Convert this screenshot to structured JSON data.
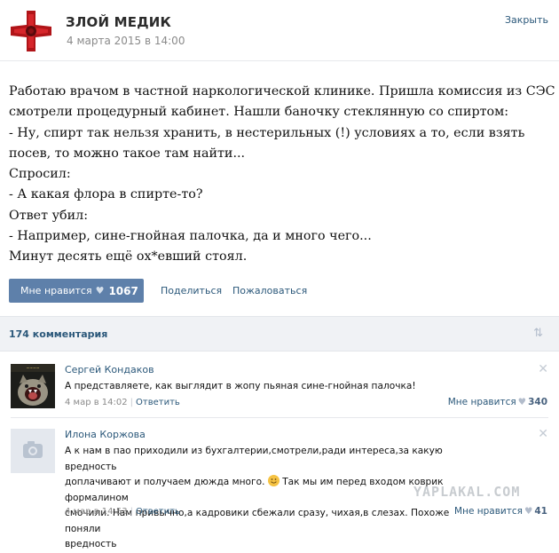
{
  "post": {
    "author": "ЗЛОЙ МЕДИК",
    "date": "4 марта 2015 в 14:00",
    "close_label": "Закрыть",
    "lines": [
      "Работаю врачом в частной наркологической клинике. Пришла комиссия из СЭС -",
      "смотрели процедурный кабинет. Нашли баночку стеклянную со спиртом:",
      "- Ну, спирт так нельзя хранить, в нестерильных (!) условиях а то, если взять",
      "посев, то можно такое там найти...",
      "Спросил:",
      "- А какая флора в спирте-то?",
      "Ответ убил:",
      "- Например, сине-гнойная палочка, да и много чего...",
      "Минут десять ещё ох*евший стоял."
    ],
    "like_label": "Мне нравится",
    "like_count": "1067",
    "share_label": "Поделиться",
    "report_label": "Пожаловаться"
  },
  "comments_bar": {
    "count_label": "174 комментария",
    "sort_icon": "sort-arrows-icon"
  },
  "comments": [
    {
      "name": "Сергей Кондаков",
      "text": "А представляете, как выглядит в жопу пьяная сине-гнойная палочка!",
      "date": "4 мар в 14:02",
      "reply_label": "Ответить",
      "like_label": "Мне нравится",
      "like_count": "340"
    },
    {
      "name": "Илона Коржова",
      "text_lines": [
        "А к нам в пао приходили из бухгалтерии,смотрели,ради интереса,за какую вредность",
        "доплачивают и получаем дюжда много.",
        "Так мы им перед входом коврик формалином",
        "смочили. Нам привычно,а кадровики сбежали сразу, чихая,в слезах. Похоже поняли",
        "вредность"
      ],
      "date": "4 мар в 14:53",
      "reply_label": "Ответить",
      "like_label": "Мне нравится",
      "like_count": "41"
    }
  ],
  "watermark": "YAPLAKAL.COM",
  "colors": {
    "link": "#2b587a",
    "button": "#5e80aa",
    "bar": "#f0f2f5"
  }
}
